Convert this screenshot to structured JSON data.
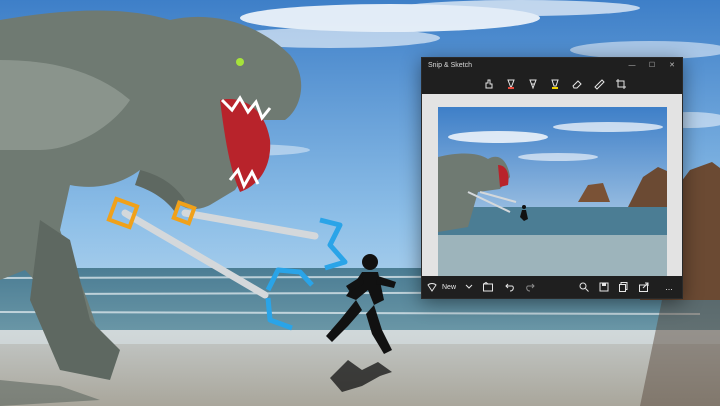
{
  "window": {
    "title": "Snip & Sketch",
    "controls": [
      "—",
      "☐",
      "✕"
    ]
  },
  "toolbar": {
    "tools": [
      {
        "name": "touch-writing-icon",
        "color": "#e6e6e6"
      },
      {
        "name": "ballpoint-pen-icon",
        "color": "#e84a3c"
      },
      {
        "name": "pencil-icon",
        "color": "#e6e6e6"
      },
      {
        "name": "highlighter-icon",
        "color": "#f2d200"
      },
      {
        "name": "eraser-icon",
        "color": "#e6e6e6"
      },
      {
        "name": "ruler-icon",
        "color": "#e6e6e6"
      },
      {
        "name": "crop-icon",
        "color": "#e6e6e6"
      }
    ]
  },
  "bottombar": {
    "new_label": "New",
    "more_label": "..."
  },
  "colors": {
    "app_chrome": "#1f1f1f",
    "app_body": "#e3e3e3",
    "sky_top": "#3e7fc8",
    "sea": "#3f6f87",
    "sand": "#b9b7ad",
    "dino": "#6f7a72",
    "grabber_blue": "#2aa4e8",
    "grabber_orange": "#f0a11a"
  }
}
